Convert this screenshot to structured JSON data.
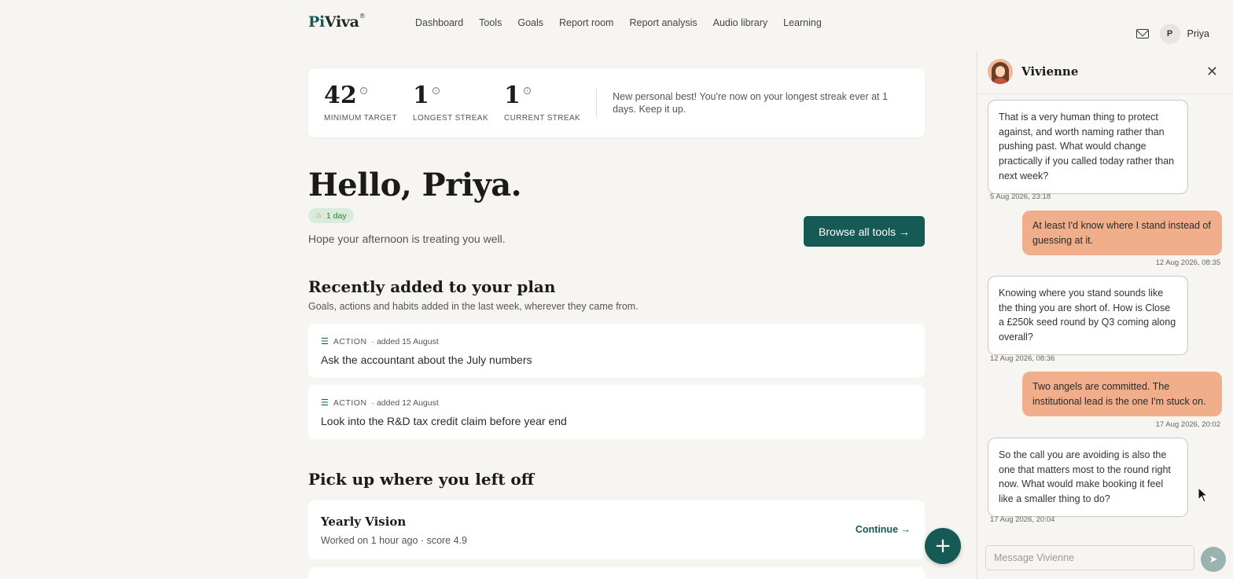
{
  "brand": {
    "logo_pi": "Pi",
    "logo_rest": "Viva",
    "logo_mark": "®"
  },
  "nav": [
    "Dashboard",
    "Tools",
    "Goals",
    "Report room",
    "Report analysis",
    "Audio library",
    "Learning"
  ],
  "user": {
    "initial": "P",
    "name": "Priya"
  },
  "stats": {
    "items": [
      {
        "value": "42",
        "label": "Minimum target"
      },
      {
        "value": "1",
        "label": "Longest streak"
      },
      {
        "value": "1",
        "label": "Current streak"
      }
    ],
    "message": "New personal best! You're now on your longest streak ever at 1 days. Keep it up."
  },
  "greeting": {
    "title": "Hello, Priya.",
    "streak": "1 day",
    "subtitle": "Hope your afternoon is treating you well.",
    "browse_label": "Browse all tools →"
  },
  "recent": {
    "title": "Recently added to your plan",
    "subtitle": "Goals, actions and habits added in the last week, wherever they came from.",
    "items": [
      {
        "type": "ACTION",
        "added": "· added 15 August",
        "title": "Ask the accountant about the July numbers"
      },
      {
        "type": "ACTION",
        "added": "· added 12 August",
        "title": "Look into the R&D tax credit claim before year end"
      }
    ]
  },
  "pickup": {
    "title": "Pick up where you left off",
    "items": [
      {
        "title": "Yearly Vision",
        "meta": "Worked on 1 hour ago · score 4.9",
        "action": "Continue →"
      }
    ]
  },
  "chat": {
    "name": "Vivienne",
    "messages": [
      {
        "from": "coach",
        "text": "That is a very human thing to protect against, and worth naming rather than pushing past. What would change practically if you called today rather than next week?",
        "time": "5 Aug 2026, 23:18"
      },
      {
        "from": "user",
        "text": "At least I'd know where I stand instead of guessing at it.",
        "time": "12 Aug 2026, 08:35"
      },
      {
        "from": "coach",
        "text": "Knowing where you stand sounds like the thing you are short of. How is Close a £250k seed round by Q3 coming along overall?",
        "time": "12 Aug 2026, 08:36"
      },
      {
        "from": "user",
        "text": "Two angels are committed. The institutional lead is the one I'm stuck on.",
        "time": "17 Aug 2026, 20:02"
      },
      {
        "from": "coach",
        "text": "So the call you are avoiding is also the one that matters most to the round right now. What would make booking it feel like a smaller thing to do?",
        "time": "17 Aug 2026, 20:04"
      }
    ],
    "placeholder": "Message Vivienne"
  },
  "colors": {
    "brand": "#155a55",
    "user_bubble": "#f1ae8b",
    "streak_bg": "#d9ecdb"
  }
}
